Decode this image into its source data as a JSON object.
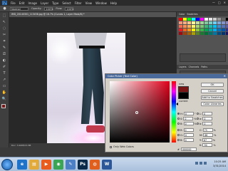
{
  "menubar": {
    "logo": "Ps",
    "items": [
      "File",
      "Edit",
      "Image",
      "Layer",
      "Type",
      "Select",
      "Filter",
      "View",
      "Window",
      "Help"
    ],
    "window_buttons": [
      "—",
      "□",
      "✕"
    ]
  },
  "options_bar": {
    "mode_value": "Normal",
    "opacity_label": "Opacity:",
    "opacity_value": "100%",
    "flow_label": "Flow:",
    "flow_value": "100%"
  },
  "tools": [
    "⬚",
    "↖",
    "◌",
    "✂",
    "⌗",
    "✎",
    "⎚",
    "◐",
    "✐",
    "T",
    "↗",
    "▭",
    "✋",
    "🔍"
  ],
  "document": {
    "tab_title": "IMG_20140301_113438.jpg @ 16.7% (Curves 1, Layer Mask/8) *",
    "status": "Doc: 3.44M/15.3M"
  },
  "right_panel": {
    "tabs": [
      "Color",
      "Swatches"
    ],
    "layers_tabs": [
      "Layers",
      "Channels",
      "Paths"
    ],
    "swatch_colors": [
      "#ff0000",
      "#ffff00",
      "#00ff00",
      "#00ffff",
      "#0000ff",
      "#ff00ff",
      "#ffffff",
      "#e6e6e6",
      "#cccccc",
      "#999999",
      "#666666",
      "#000000",
      "#f7977a",
      "#f9ad81",
      "#fdc68a",
      "#fff79a",
      "#c4df9b",
      "#a2d39c",
      "#82ca9d",
      "#7bcdc8",
      "#6ecff6",
      "#7ea7d8",
      "#8493ca",
      "#8882be",
      "#f26c4f",
      "#f68e55",
      "#fbaf5c",
      "#fff467",
      "#acd372",
      "#7cc576",
      "#3bb878",
      "#1abbb4",
      "#00bff3",
      "#438ccb",
      "#5574b9",
      "#605ca8",
      "#ed1c24",
      "#f26522",
      "#f7941d",
      "#fff200",
      "#8dc73f",
      "#39b54a",
      "#00a651",
      "#00a99d",
      "#00aeef",
      "#0072bc",
      "#0054a6",
      "#2e3192",
      "#9e0b0f",
      "#a0410d",
      "#a36209",
      "#aba000",
      "#598527",
      "#1a7b30",
      "#007236",
      "#00746b",
      "#0076a3",
      "#004b80",
      "#003471",
      "#1b1464"
    ]
  },
  "color_picker": {
    "title": "Color Picker (Text Color)",
    "close": "✕",
    "new_label": "new",
    "current_label": "current",
    "new_color": "#7a1616",
    "current_color": "#000000",
    "buttons": [
      "OK",
      "Cancel",
      "Add to Swatches",
      "Color Libraries"
    ],
    "hsb": [
      {
        "label": "H:",
        "value": "0",
        "unit": "°",
        "selected": true
      },
      {
        "label": "S:",
        "value": "0",
        "unit": "%",
        "selected": false
      },
      {
        "label": "B:",
        "value": "0",
        "unit": "%",
        "selected": false
      },
      {
        "label": "R:",
        "value": "0",
        "unit": "",
        "selected": false
      },
      {
        "label": "G:",
        "value": "0",
        "unit": "",
        "selected": false
      },
      {
        "label": "B:",
        "value": "0",
        "unit": "",
        "selected": false
      }
    ],
    "lab": [
      {
        "label": "L:",
        "value": "0"
      },
      {
        "label": "a:",
        "value": "0"
      },
      {
        "label": "b:",
        "value": "0"
      }
    ],
    "cmyk": [
      {
        "label": "C:",
        "value": "75",
        "unit": "%"
      },
      {
        "label": "M:",
        "value": "68",
        "unit": "%"
      },
      {
        "label": "Y:",
        "value": "67",
        "unit": "%"
      },
      {
        "label": "K:",
        "value": "90",
        "unit": "%"
      }
    ],
    "only_web_colors": "Only Web Colors",
    "hex_label": "#",
    "hex_value": "000000"
  },
  "taskbar": {
    "time": "10:25 AM",
    "date": "3/31/2014",
    "apps": [
      {
        "name": "ie-icon",
        "glyph": "e",
        "color": "#1e73c8"
      },
      {
        "name": "folder-icon",
        "glyph": "▤",
        "color": "#e2a93b"
      },
      {
        "name": "media-player-icon",
        "glyph": "▶",
        "color": "#e85d1e"
      },
      {
        "name": "chrome-icon",
        "glyph": "◉",
        "color": "#3aa655"
      },
      {
        "name": "paint-icon",
        "glyph": "✎",
        "color": "#4d7fc4"
      },
      {
        "name": "photoshop-icon",
        "glyph": "Ps",
        "color": "#0b2a4a"
      },
      {
        "name": "firefox-icon",
        "glyph": "◍",
        "color": "#e05f1c"
      },
      {
        "name": "word-icon",
        "glyph": "W",
        "color": "#2b579a"
      }
    ]
  }
}
